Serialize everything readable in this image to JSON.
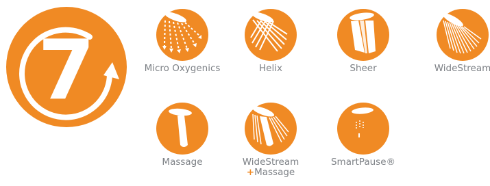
{
  "badge": {
    "number": "7",
    "color": "#f08a24"
  },
  "features": [
    {
      "name": "Micro Oxygenics",
      "icon": "micro-oxygenics-spray-icon"
    },
    {
      "name": "Helix",
      "icon": "helix-spray-icon"
    },
    {
      "name": "Sheer",
      "icon": "sheer-spray-icon"
    },
    {
      "name": "WideStream",
      "icon": "widestream-spray-icon"
    },
    {
      "name": "Massage",
      "icon": "massage-spray-icon"
    },
    {
      "name": "WideStream",
      "plus": "+",
      "name2": "Massage",
      "icon": "widestream-massage-spray-icon"
    },
    {
      "name": "SmartPause®",
      "icon": "smartpause-icon"
    }
  ],
  "colors": {
    "orange": "#f08a24",
    "label": "#7d8186",
    "white": "#ffffff"
  }
}
